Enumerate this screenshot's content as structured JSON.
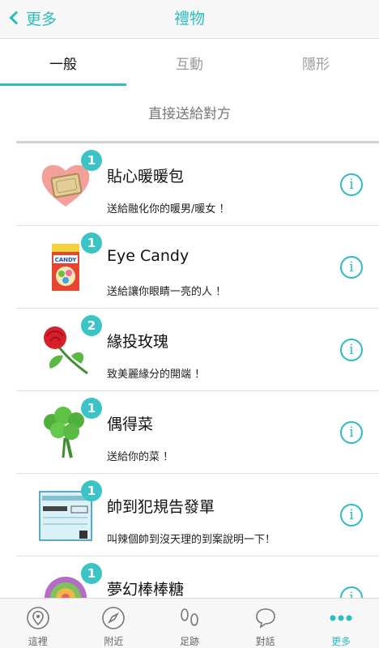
{
  "nav": {
    "back_label": "更多",
    "title": "禮物"
  },
  "tabs": [
    {
      "label": "一般",
      "active": true
    },
    {
      "label": "互動",
      "active": false
    },
    {
      "label": "隱形",
      "active": false
    }
  ],
  "subtitle": "直接送給對方",
  "items": [
    {
      "badge": "1",
      "title": "貼心暖暖包",
      "desc": "送給融化你的暖男/暖女 ！",
      "icon": "heart-warmer-pack-icon"
    },
    {
      "badge": "1",
      "title": "Eye Candy",
      "desc": "送給讓你眼睛一亮的人 ！",
      "icon": "candy-box-icon"
    },
    {
      "badge": "2",
      "title": "緣投玫瑰",
      "desc": "致美麗緣分的開端 ！",
      "icon": "rose-icon"
    },
    {
      "badge": "1",
      "title": "偶得菜",
      "desc": "送給你的菜 ！",
      "icon": "vegetable-bunch-icon"
    },
    {
      "badge": "1",
      "title": "帥到犯規告發單",
      "desc": "叫辣個帥到沒天理的到案說明一下！",
      "icon": "ticket-icon"
    },
    {
      "badge": "1",
      "title": "夢幻棒棒糖",
      "desc": "",
      "icon": "lollipop-icon"
    }
  ],
  "info_glyph": "i",
  "tabbar": [
    {
      "label": "這裡",
      "icon": "location-pin-icon"
    },
    {
      "label": "附近",
      "icon": "compass-icon"
    },
    {
      "label": "足跡",
      "icon": "footprints-icon"
    },
    {
      "label": "對話",
      "icon": "chat-bubble-icon"
    },
    {
      "label": "更多",
      "icon": "more-dots-icon",
      "active": true
    }
  ],
  "colors": {
    "accent": "#2bbdbf",
    "badge": "#3cc3c6"
  }
}
